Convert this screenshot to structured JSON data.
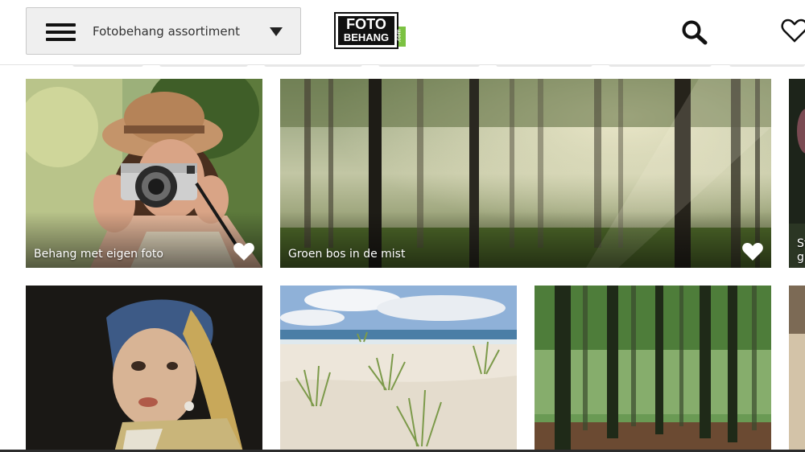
{
  "header": {
    "menu_label": "Fotobehang assortiment",
    "logo_line1": "FOTO",
    "logo_line2": "BEHANG",
    "logo_suffix": ".com",
    "icons": [
      "hamburger-menu-icon",
      "chevron-down-icon",
      "search-icon",
      "heart-icon"
    ]
  },
  "cards": [
    {
      "caption": "Behang met eigen foto",
      "favorite_icon": "heart-icon"
    },
    {
      "caption": "Groen bos in de mist",
      "favorite_icon": "heart-icon"
    },
    {
      "caption": "St\ngr",
      "partial": true
    },
    {
      "caption": "",
      "subject": "Meisje met de parel painting"
    },
    {
      "caption": "",
      "subject": "Beach dunes with grass"
    },
    {
      "caption": "",
      "subject": "Green forest"
    }
  ],
  "colors": {
    "accent_green": "#7cc242",
    "menu_bg": "#efefef",
    "text_dark": "#333333"
  }
}
